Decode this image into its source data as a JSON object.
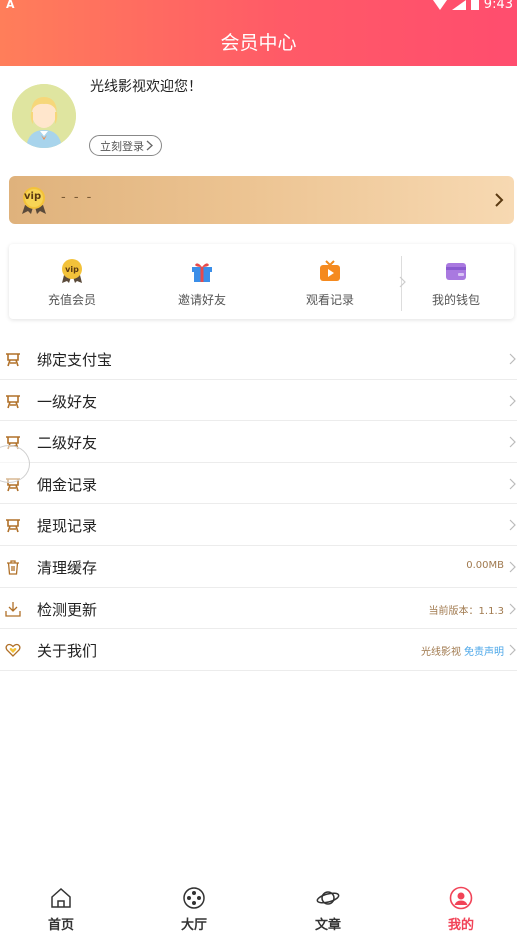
{
  "status_bar": {
    "left_glyph": "A",
    "time": "9:43"
  },
  "header": {
    "title": "会员中心"
  },
  "profile": {
    "welcome": "光线影视欢迎您！",
    "login_label": "立刻登录"
  },
  "vip_banner": {
    "badge": "vip",
    "text": "- - -"
  },
  "quick_actions": [
    {
      "label": "充值会员",
      "icon": "vip-medal-icon"
    },
    {
      "label": "邀请好友",
      "icon": "gift-icon"
    },
    {
      "label": "观看记录",
      "icon": "tv-play-icon"
    },
    {
      "label": "我的钱包",
      "icon": "wallet-icon"
    }
  ],
  "menu": [
    {
      "label": "绑定支付宝",
      "icon": "easel-icon",
      "right": ""
    },
    {
      "label": "一级好友",
      "icon": "easel-icon",
      "right": ""
    },
    {
      "label": "二级好友",
      "icon": "easel-icon",
      "right": ""
    },
    {
      "label": "佣金记录",
      "icon": "easel-icon",
      "right": ""
    },
    {
      "label": "提现记录",
      "icon": "easel-icon",
      "right": ""
    },
    {
      "label": "清理缓存",
      "icon": "trash-icon",
      "right": "0.00MB"
    },
    {
      "label": "检测更新",
      "icon": "download-icon",
      "right": "当前版本：1.1.3"
    },
    {
      "label": "关于我们",
      "icon": "heart-icon",
      "right": "光线影视",
      "right_link": "免责声明"
    }
  ],
  "bottom_nav": [
    {
      "label": "首页",
      "icon": "home-icon"
    },
    {
      "label": "大厅",
      "icon": "film-reel-icon"
    },
    {
      "label": "文章",
      "icon": "planet-icon"
    },
    {
      "label": "我的",
      "icon": "user-icon",
      "active": true
    }
  ],
  "colors": {
    "header_start": "#ff7e5a",
    "header_end": "#ff4d6e",
    "active_nav": "#f14357",
    "vip_text": "#7a5a35"
  }
}
